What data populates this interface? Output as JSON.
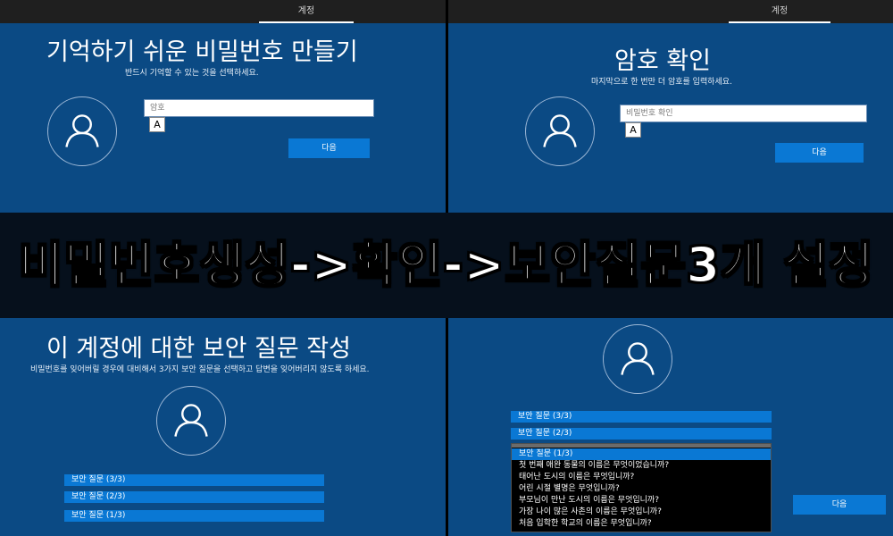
{
  "panel1": {
    "tab_label": "계정",
    "title": "기억하기 쉬운 비밀번호 만들기",
    "subtitle": "반드시 기억할 수 있는 것을 선택하세요.",
    "password_placeholder": "암호",
    "ime_indicator": "A",
    "next_label": "다음"
  },
  "panel2": {
    "tab_label": "계정",
    "title": "암호 확인",
    "subtitle": "마지막으로 한 번만 더 암호를 입력하세요.",
    "confirm_placeholder": "비밀번호 확인",
    "ime_indicator": "A",
    "next_label": "다음"
  },
  "banner": {
    "text": "비밀번호생성->확인->보안질문3개 설정"
  },
  "panel3": {
    "title": "이 계정에 대한 보안 질문 작성",
    "subtitle": "비밀번호를 잊어버릴 경우에 대비해서 3가지 보안 질문을 선택하고 답변을 잊어버리지 않도록 하세요.",
    "questions": [
      "보안 질문 (3/3)",
      "보안 질문 (2/3)",
      "보안 질문 (1/3)"
    ]
  },
  "panel4": {
    "questions": [
      "보안 질문 (3/3)",
      "보안 질문 (2/3)"
    ],
    "dropdown": {
      "selected": "보안 질문 (1/3)",
      "options": [
        "첫 번째 애완 동물의 이름은 무엇이었습니까?",
        "태어난 도시의 이름은 무엇입니까?",
        "어린 시절 별명은 무엇입니까?",
        "부모님이 만난 도시의 이름은 무엇입니까?",
        "가장 나이 많은 사촌의 이름은 무엇입니까?",
        "처음 입학한 학교의 이름은 무엇입니까?"
      ]
    },
    "next_label": "다음"
  },
  "colors": {
    "panel_bg": "#0b4a84",
    "accent": "#0a78d4",
    "topbar": "#1f1f1f",
    "banner_bg": "#06101c"
  }
}
